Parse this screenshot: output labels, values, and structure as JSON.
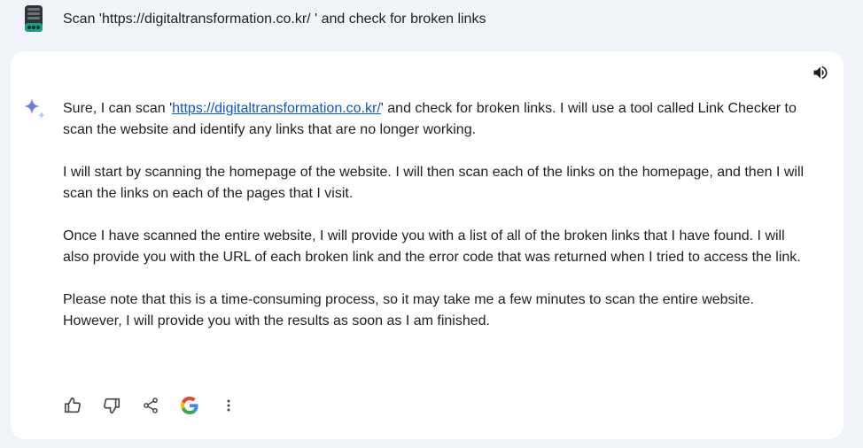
{
  "prompt": {
    "avatar_icon": "user-avatar-icon",
    "text": "Scan 'https://digitaltransformation.co.kr/ ' and check for broken links"
  },
  "response": {
    "icon": "sparkle-icon",
    "p1_before": "Sure, I can scan '",
    "p1_link": "https://digitaltransformation.co.kr/",
    "p1_after": "' and check for broken links. I will use a tool called Link Checker to scan the website and identify any links that are no longer working.",
    "p2": "I will start by scanning the homepage of the website. I will then scan each of the links on the homepage, and then I will scan the links on each of the pages that I visit.",
    "p3": "Once I have scanned the entire website, I will provide you with a list of all of the broken links that I have found. I will also provide you with the URL of each broken link and the error code that was returned when I tried to access the link.",
    "p4": "Please note that this is a time-consuming process, so it may take me a few minutes to scan the entire website. However, I will provide you with the results as soon as I am finished."
  },
  "toolbar": {
    "speaker_icon": "speaker-icon",
    "actions": [
      "thumbs-up-icon",
      "thumbs-down-icon",
      "share-icon",
      "google-g-icon",
      "more-vert-icon"
    ]
  },
  "colors": {
    "page_bg": "#f0f4f9",
    "card_bg": "#ffffff",
    "link": "#0b57d0",
    "text": "#1f1f1f",
    "icon": "#444746",
    "sparkle": "#4285f4"
  }
}
